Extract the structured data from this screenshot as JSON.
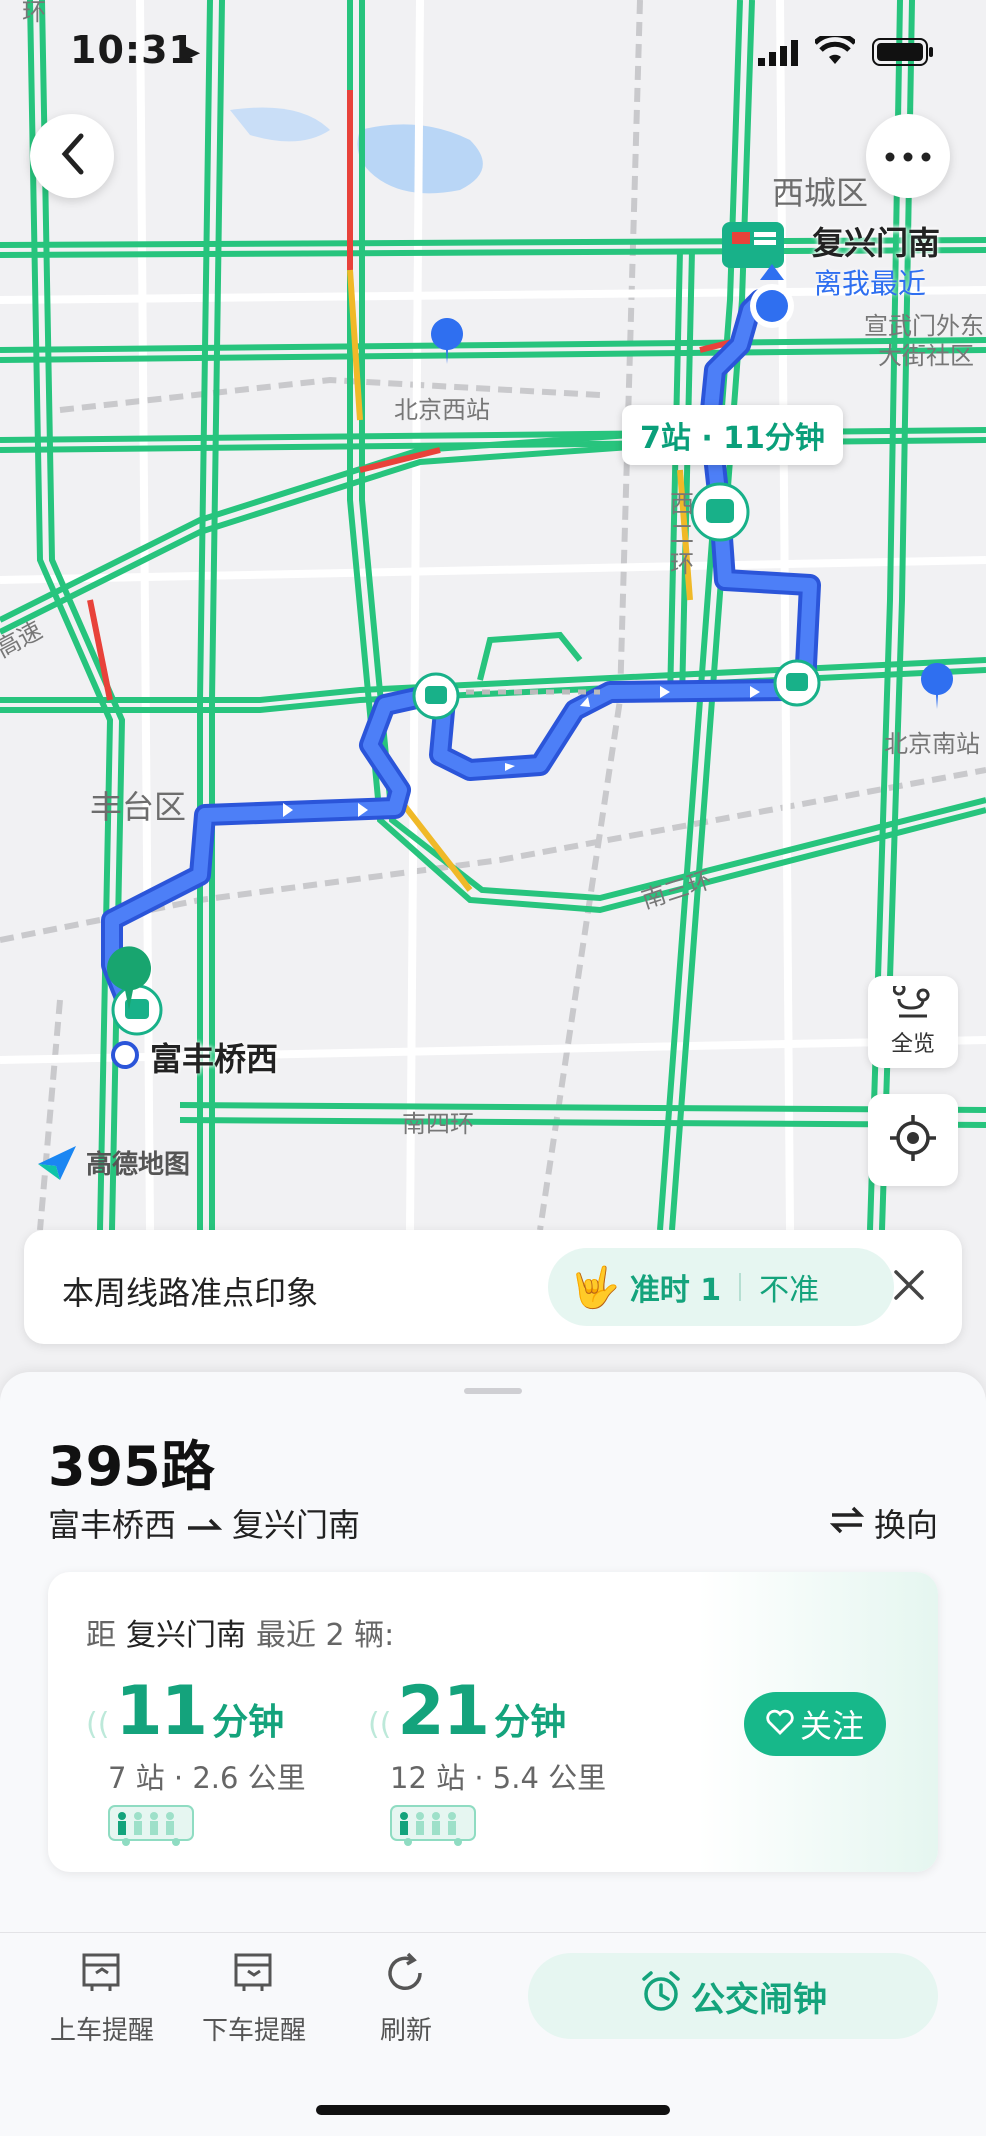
{
  "status_bar": {
    "time": "10:31"
  },
  "map": {
    "labels": {
      "district_xicheng": "西城区",
      "district_fengtai": "丰台区",
      "beijing_west": "北京西站",
      "beijing_south": "北京南站",
      "xuanwu": "宣武门外东",
      "xuanwu2": "大街社区",
      "second_ring_1": "西",
      "second_ring_2": "二",
      "second_ring_3": "环",
      "third_ring": "南三环",
      "fourth_ring": "南四环",
      "highway": "高速",
      "top_left": "环"
    },
    "destination": {
      "name": "复兴门南",
      "nearest": "离我最近"
    },
    "origin": {
      "name": "富丰桥西"
    },
    "bubble": "7站 · 11分钟",
    "logo": "高德地图",
    "overview_label": "全览"
  },
  "punctuality": {
    "title": "本周线路准点印象",
    "on_time": "准时 1",
    "not_on_time": "不准"
  },
  "route": {
    "name": "395路",
    "from": "富丰桥西",
    "to": "复兴门南",
    "swap_label": "换向",
    "distance_prefix": "距",
    "stop": "复兴门南",
    "distance_suffix": "最近 2 辆:",
    "arrivals": [
      {
        "minutes": "11",
        "unit": "分钟",
        "detail": "7 站 · 2.6 公里"
      },
      {
        "minutes": "21",
        "unit": "分钟",
        "detail": "12 站 · 5.4 公里"
      }
    ],
    "follow_label": "关注"
  },
  "bottom_bar": {
    "board_reminder": "上车提醒",
    "alight_reminder": "下车提醒",
    "refresh": "刷新",
    "bus_alarm": "公交闹钟"
  },
  "colors": {
    "accent": "#14a37c",
    "route_blue": "#3b6ff5",
    "road_green": "#27c47d"
  }
}
